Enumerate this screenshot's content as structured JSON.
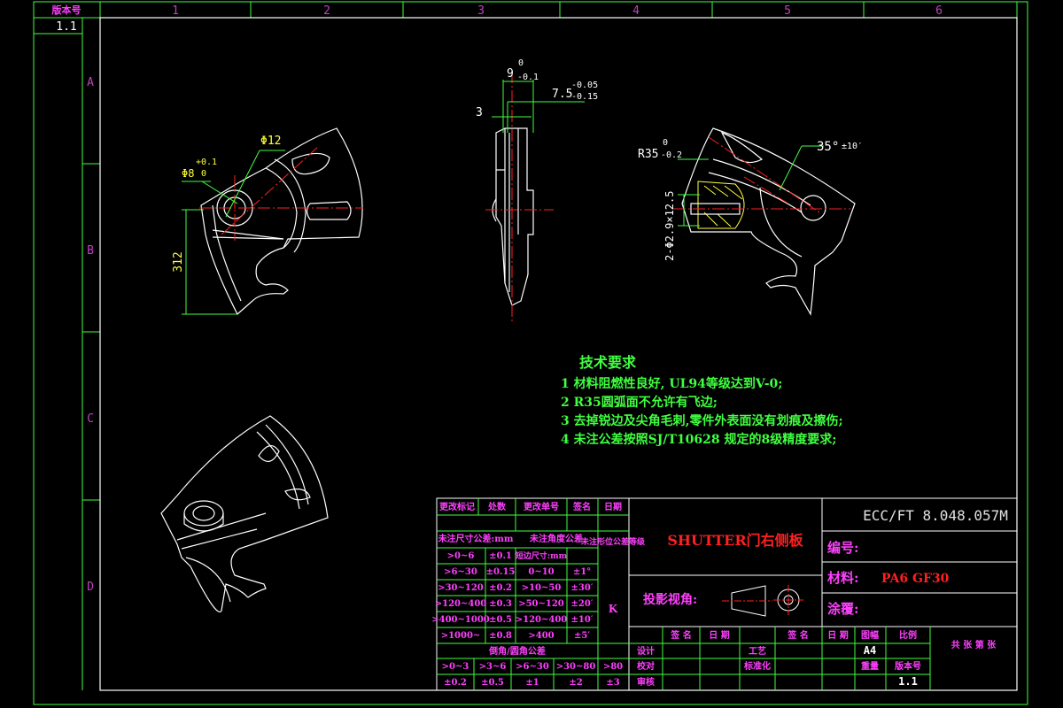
{
  "frame": {
    "top_left_label": "版本号",
    "version_cell": "1.1",
    "columns": [
      "1",
      "2",
      "3",
      "4",
      "5",
      "6"
    ],
    "rows": [
      "A",
      "B",
      "C",
      "D"
    ]
  },
  "dimensions": {
    "d8": "Φ8",
    "d8_tol_upper": "+0.1",
    "d8_tol_lower": "0",
    "d12": "Φ12",
    "len312": "312",
    "w9": "9",
    "w9_tol_upper": "0",
    "w9_tol_lower": "-0.1",
    "w75": "7.5",
    "w75_tol_upper": "-0.05",
    "w75_tol_lower": "-0.15",
    "w3": "3",
    "r35": "R35",
    "r35_tol_upper": "0",
    "r35_tol_lower": "-0.2",
    "ang35": "35°",
    "ang35_tol": "±10′",
    "holes": "2-Φ2.9×12.5"
  },
  "tech": {
    "title": "技术要求",
    "items": [
      "1  材料阻燃性良好, UL94等级达到V-0;",
      "2  R35圆弧面不允许有飞边;",
      "3  去掉锐边及尖角毛刺,零件外表面没有划痕及擦伤;",
      "4  未注公差按照SJ/T10628 规定的8级精度要求;"
    ]
  },
  "title_block": {
    "drawing_no": "ECC/FT 8.048.057M",
    "part_name": "SHUTTER门右侧板",
    "code_label": "编号:",
    "material_label": "材料:",
    "material_value": "PA6 GF30",
    "coating_label": "涂覆:",
    "projection_label": "投影视角:",
    "header": [
      "更改标记",
      "处数",
      "更改单号",
      "签名",
      "日期"
    ],
    "tol_title": "未注尺寸公差:mm",
    "angle_title": "未注角度公差",
    "shape_tol": "未注形位公差等级",
    "shape_tol_value": "K",
    "tol_rows": [
      [
        ">0~6",
        "±0.1",
        "短边尺寸:mm",
        ""
      ],
      [
        ">6~30",
        "±0.15",
        "0~10",
        "±1°"
      ],
      [
        ">30~120",
        "±0.2",
        ">10~50",
        "±30′"
      ],
      [
        ">120~400",
        "±0.3",
        ">50~120",
        "±20′"
      ],
      [
        ">400~1000",
        "±0.5",
        ">120~400",
        "±10′"
      ],
      [
        ">1000~",
        "±0.8",
        ">400",
        "±5′"
      ]
    ],
    "chamfer_title": "倒角/圆角公差",
    "chamfer_ranges": [
      ">0~3",
      ">3~6",
      ">6~30",
      ">30~80",
      ">80"
    ],
    "chamfer_tols": [
      "±0.2",
      "±0.5",
      "±1",
      "±2",
      "±3"
    ],
    "sign_row": [
      "签 名",
      "日 期",
      "签 名",
      "日 期"
    ],
    "design": "设计",
    "check": "校对",
    "audit": "审核",
    "process": "工艺",
    "standard": "标准化",
    "drawing_size_label": "图幅",
    "drawing_size": "A4",
    "scale_label": "比例",
    "sheets": "共 张 第 张",
    "weight_label": "重量",
    "version_label": "版本号",
    "version_value": "1.1"
  }
}
